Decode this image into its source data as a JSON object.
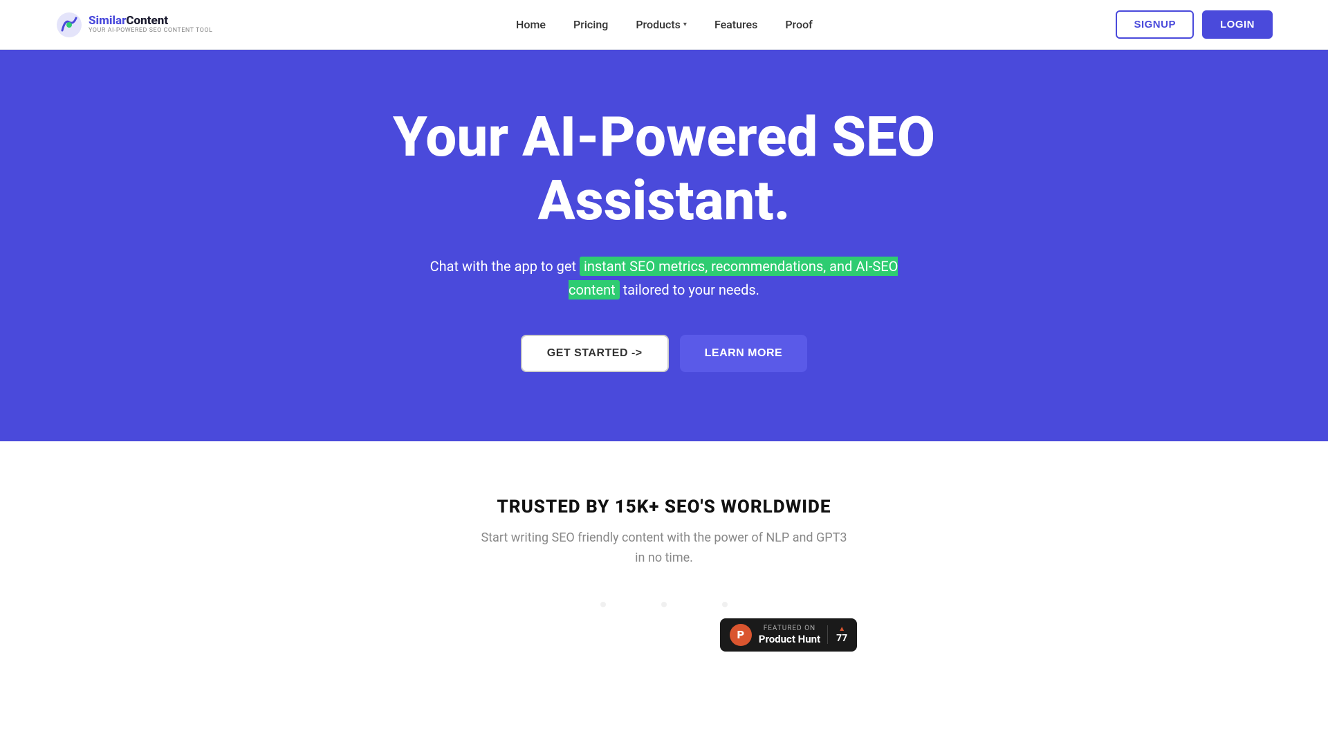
{
  "nav": {
    "logo": {
      "similar": "Similar",
      "content": "Content",
      "tagline": "YOUR AI-POWERED SEO CONTENT TOOL"
    },
    "links": [
      {
        "label": "Home",
        "id": "home"
      },
      {
        "label": "Pricing",
        "id": "pricing"
      },
      {
        "label": "Products",
        "id": "products",
        "hasDropdown": true
      },
      {
        "label": "Features",
        "id": "features"
      },
      {
        "label": "Proof",
        "id": "proof"
      }
    ],
    "signup_label": "SIGNUP",
    "login_label": "LOGIN"
  },
  "hero": {
    "title": "Your AI-Powered SEO Assistant.",
    "subtitle_before": "Chat with the app to get ",
    "subtitle_highlight": "instant SEO metrics, recommendations, and AI-SEO content",
    "subtitle_after": " tailored to your needs.",
    "cta_primary": "GET STARTED ->",
    "cta_secondary": "LEARN MORE"
  },
  "trusted": {
    "title": "TRUSTED BY 15K+ SEO'S WORLDWIDE",
    "subtitle": "Start writing SEO friendly content with the power of NLP and GPT3\nin no time.",
    "product_hunt": {
      "featured_label": "FEATURED ON",
      "name": "Product Hunt",
      "votes": "77",
      "arrow": "▲"
    }
  }
}
